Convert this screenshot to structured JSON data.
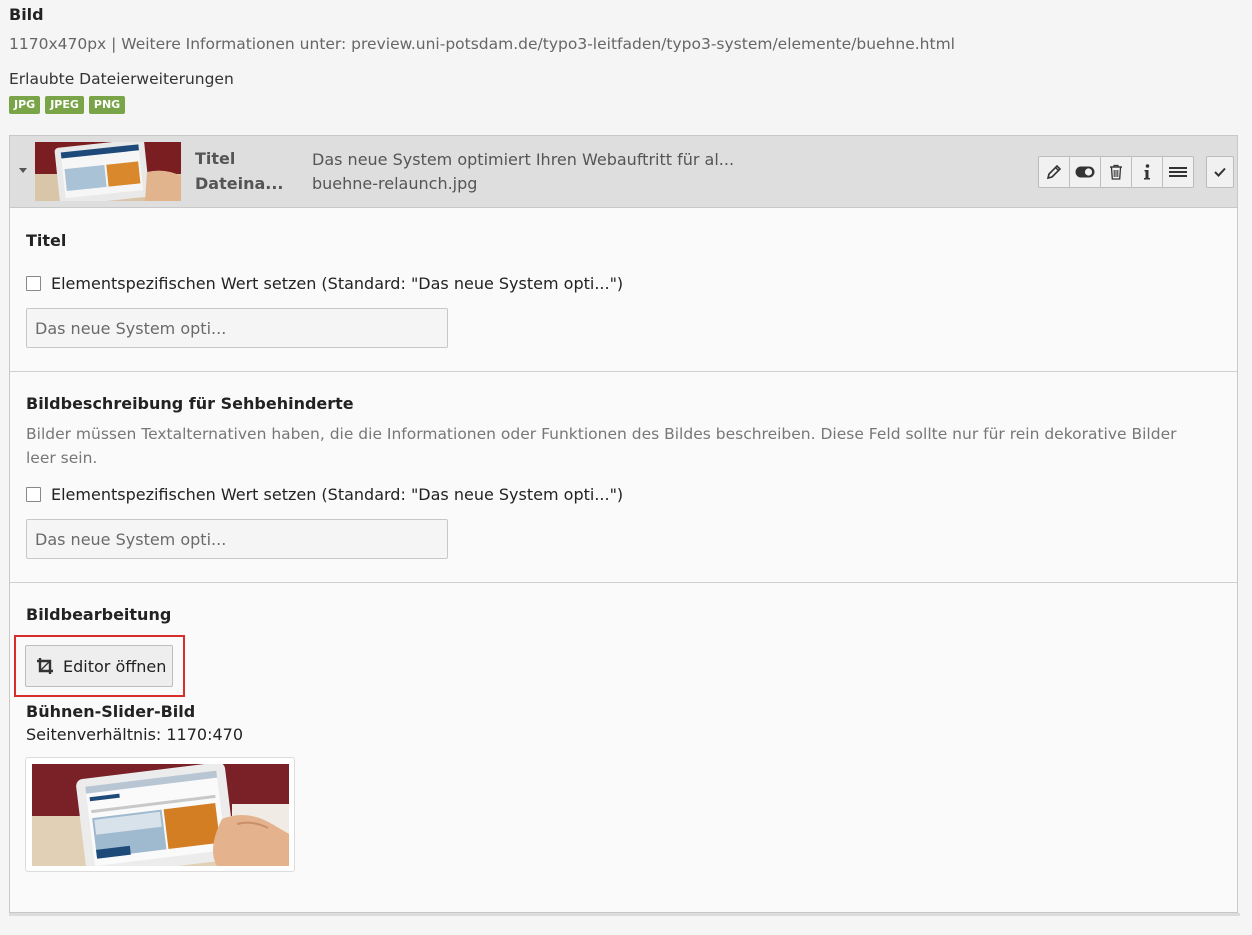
{
  "field": {
    "title": "Bild",
    "description": "1170x470px | Weitere Informationen unter: preview.uni-potsdam.de/typo3-leitfaden/typo3-system/elemente/buehne.html",
    "extensions_label": "Erlaubte Dateierweiterungen",
    "extensions": [
      "JPG",
      "JPEG",
      "PNG"
    ]
  },
  "file": {
    "title_label": "Titel",
    "title_value": "Das neue System optimiert Ihren Webauftritt für al...",
    "filename_label": "Dateina...",
    "filename_value": "buehne-relaunch.jpg",
    "actions": [
      "edit-icon",
      "toggle-icon",
      "trash-icon",
      "info-icon",
      "menu-icon",
      "check-icon"
    ]
  },
  "title_section": {
    "heading": "Titel",
    "checkbox_label": "Elementspezifischen Wert setzen (Standard: \"Das neue System opti...\")",
    "placeholder": "Das neue System opti..."
  },
  "alt_section": {
    "heading": "Bildbeschreibung für Sehbehinderte",
    "description": "Bilder müssen Textalternativen haben, die die Informationen oder Funktionen des Bildes beschreiben. Diese Feld sollte nur für rein dekorative Bilder leer sein.",
    "checkbox_label": "Elementspezifischen Wert setzen (Standard: \"Das neue System opti...\")",
    "placeholder": "Das neue System opti..."
  },
  "crop_section": {
    "heading": "Bildbearbeitung",
    "button_label": "Editor öffnen",
    "variant_title": "Bühnen-Slider-Bild",
    "aspect_ratio": "Seitenverhältnis: 1170:470"
  },
  "colors": {
    "badge": "#79a548",
    "highlight": "#d82d2d",
    "header_bg": "#dedede"
  }
}
